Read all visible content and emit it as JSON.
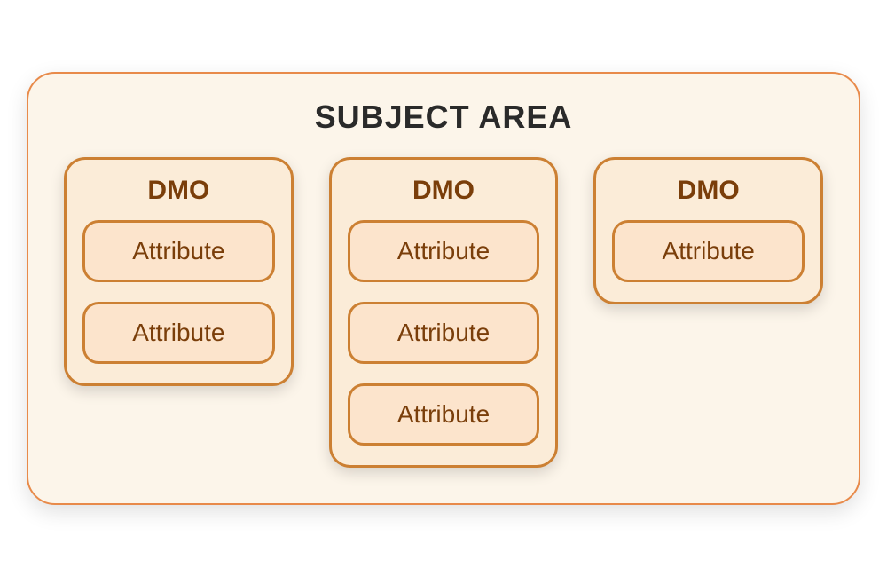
{
  "subjectArea": {
    "title": "SUBJECT AREA",
    "dmos": [
      {
        "label": "DMO",
        "attributes": [
          "Attribute",
          "Attribute"
        ]
      },
      {
        "label": "DMO",
        "attributes": [
          "Attribute",
          "Attribute",
          "Attribute"
        ]
      },
      {
        "label": "DMO",
        "attributes": [
          "Attribute"
        ]
      }
    ]
  },
  "colors": {
    "outerBg": "#fcf5ea",
    "outerBorder": "#e88a4a",
    "dmoBg": "#fbecd8",
    "dmoBorder": "#cc8033",
    "attrBg": "#fce4cc",
    "textDark": "#7a3e0a"
  }
}
